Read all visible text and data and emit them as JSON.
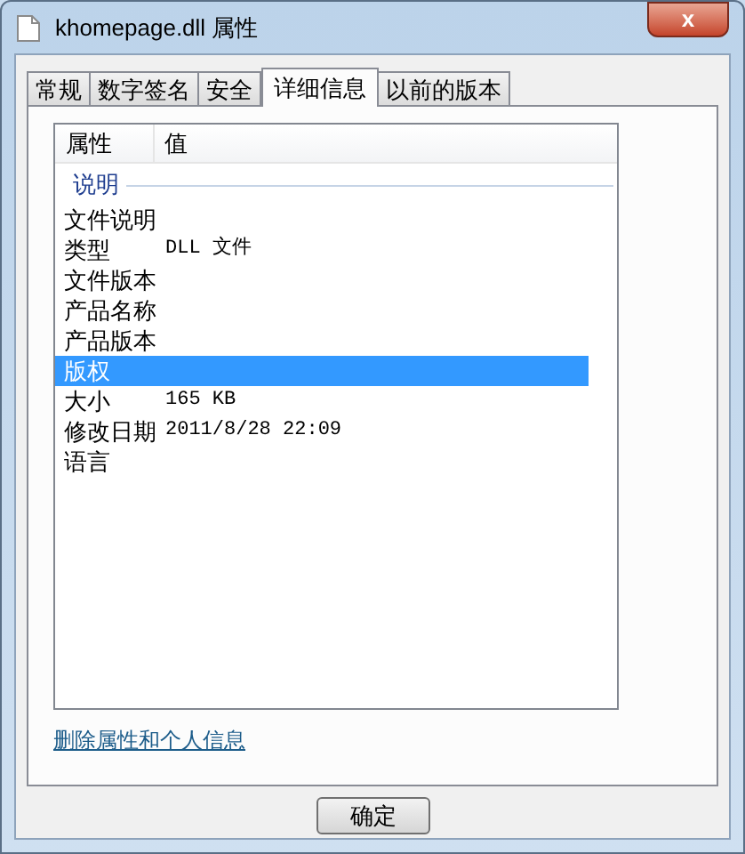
{
  "window": {
    "title": "khomepage.dll 属性",
    "close": "x"
  },
  "tabs": [
    {
      "label": "常规",
      "selected": false
    },
    {
      "label": "数字签名",
      "selected": false
    },
    {
      "label": "安全",
      "selected": false
    },
    {
      "label": "详细信息",
      "selected": true
    },
    {
      "label": "以前的版本",
      "selected": false
    }
  ],
  "list": {
    "columns": [
      "属性",
      "值"
    ],
    "rows": [
      {
        "kind": "group",
        "label": "说明"
      },
      {
        "kind": "property",
        "name": "文件说明",
        "selected": false
      },
      {
        "kind": "property",
        "name": "类型",
        "value": "DLL 文件",
        "selected": false
      },
      {
        "kind": "property",
        "name": "文件版本",
        "selected": false
      },
      {
        "kind": "property",
        "name": "产品名称",
        "selected": false
      },
      {
        "kind": "property",
        "name": "产品版本",
        "selected": false
      },
      {
        "kind": "property",
        "name": "版权",
        "selected": true
      },
      {
        "kind": "property",
        "name": "大小",
        "value": "165 KB",
        "selected": false
      },
      {
        "kind": "property",
        "name": "修改日期",
        "value": "2011/8/28 22:09",
        "selected": false
      },
      {
        "kind": "property",
        "name": "语言",
        "selected": false
      }
    ]
  },
  "link": "删除属性和个人信息",
  "buttons": [
    "确定"
  ]
}
